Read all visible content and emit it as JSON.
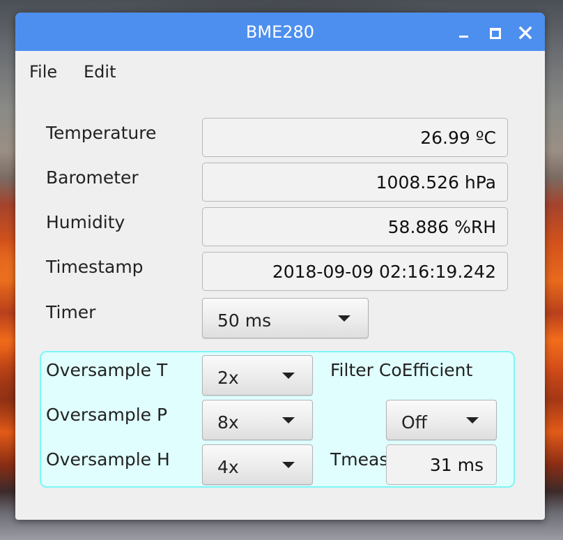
{
  "window": {
    "title": "BME280",
    "titlebar_color": "#4d8fef",
    "controls": {
      "minimize_icon": "minimize-icon",
      "maximize_icon": "maximize-icon",
      "close_icon": "close-icon"
    }
  },
  "menu": {
    "file": "File",
    "edit": "Edit"
  },
  "readings": {
    "temperature_label": "Temperature",
    "temperature_value": "26.99 ºC",
    "barometer_label": "Barometer",
    "barometer_value": "1008.526 hPa",
    "humidity_label": "Humidity",
    "humidity_value": "58.886 %RH",
    "timestamp_label": "Timestamp",
    "timestamp_value": "2018-09-09 02:16:19.242"
  },
  "timer": {
    "label": "Timer",
    "value": "50 ms"
  },
  "settings": {
    "group_color": "#e0fefe",
    "group_border_color": "#7ef5f5",
    "oversample_t_label": "Oversample T",
    "oversample_t_value": "2x",
    "oversample_p_label": "Oversample P",
    "oversample_p_value": "8x",
    "oversample_h_label": "Oversample H",
    "oversample_h_value": "4x",
    "filter_label": "Filter CoEfficient",
    "filter_value": "Off",
    "tmeas_label": "Tmeas",
    "tmeas_value": "31 ms"
  }
}
